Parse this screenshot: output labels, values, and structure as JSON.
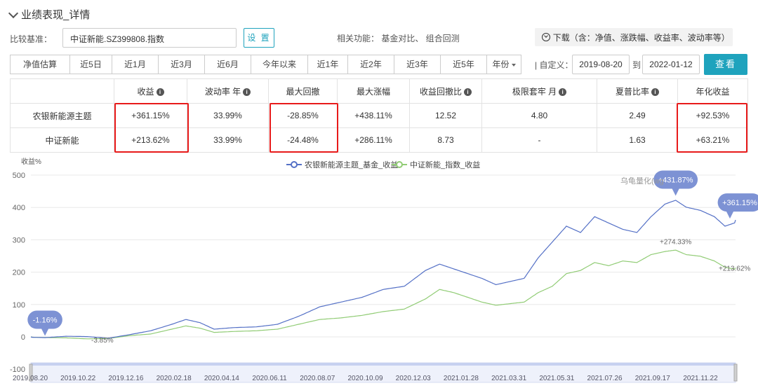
{
  "section_title": "业绩表现_详情",
  "compare": {
    "label": "比较基准：",
    "benchmark_value": "中证新能.SZ399808.指数",
    "set_button": "设 置",
    "related": "相关功能： 基金对比、 组合回测",
    "download": "下载（含：净值、涨跌幅、收益率、波动率等）"
  },
  "periods": [
    "净值估算",
    "近5日",
    "近1月",
    "近3月",
    "近6月",
    "今年以来",
    "近1年",
    "近2年",
    "近3年",
    "近5年"
  ],
  "year_select": "年份",
  "custom_label": "| 自定义：",
  "date_from": "2019-08-20",
  "to_label": "到",
  "date_to": "2022-01-12",
  "query_button": "查看",
  "table": {
    "headers": [
      "",
      "收益",
      "波动率 年",
      "最大回撤",
      "最大涨幅",
      "收益回撤比",
      "极限套牢 月",
      "夏普比率",
      "年化收益"
    ],
    "rows": [
      [
        "农银新能源主题",
        "+361.15%",
        "33.99%",
        "-28.85%",
        "+438.11%",
        "12.52",
        "4.80",
        "2.49",
        "+92.53%"
      ],
      [
        "中证新能",
        "+213.62%",
        "33.99%",
        "-24.48%",
        "+286.11%",
        "8.73",
        "-",
        "1.63",
        "+63.21%"
      ]
    ]
  },
  "colors": {
    "accent": "#1fa3bd",
    "highlight_box": "#e81a1a",
    "positive": "#e0353a",
    "negative": "#2e9a45",
    "series_fund": "#5470c6",
    "series_index": "#91cc75"
  },
  "chart_data": {
    "type": "line",
    "ylabel": "收益%",
    "ylim": [
      -100,
      500
    ],
    "yticks": [
      -100,
      0,
      100,
      200,
      300,
      400,
      500
    ],
    "grid": true,
    "legend_position": "top-center",
    "x_ticks": [
      "2019.08.20",
      "2019.10.22",
      "2019.12.16",
      "2020.02.18",
      "2020.04.14",
      "2020.06.11",
      "2020.08.07",
      "2020.10.09",
      "2020.12.03",
      "2021.01.28",
      "2021.03.31",
      "2021.05.31",
      "2021.07.26",
      "2021.09.17",
      "2021.11.22"
    ],
    "series": [
      {
        "name": "农银新能源主题_基金_收益",
        "color": "#5470c6",
        "points": [
          [
            0,
            0
          ],
          [
            0.02,
            -1.16
          ],
          [
            0.05,
            3
          ],
          [
            0.08,
            2
          ],
          [
            0.11,
            -3
          ],
          [
            0.14,
            8
          ],
          [
            0.17,
            20
          ],
          [
            0.2,
            40
          ],
          [
            0.22,
            55
          ],
          [
            0.24,
            45
          ],
          [
            0.26,
            25
          ],
          [
            0.29,
            30
          ],
          [
            0.32,
            32
          ],
          [
            0.35,
            40
          ],
          [
            0.38,
            65
          ],
          [
            0.41,
            95
          ],
          [
            0.44,
            110
          ],
          [
            0.47,
            125
          ],
          [
            0.5,
            150
          ],
          [
            0.53,
            160
          ],
          [
            0.56,
            210
          ],
          [
            0.58,
            230
          ],
          [
            0.6,
            215
          ],
          [
            0.62,
            200
          ],
          [
            0.64,
            185
          ],
          [
            0.66,
            165
          ],
          [
            0.68,
            175
          ],
          [
            0.7,
            185
          ],
          [
            0.72,
            250
          ],
          [
            0.74,
            300
          ],
          [
            0.76,
            350
          ],
          [
            0.78,
            330
          ],
          [
            0.8,
            380
          ],
          [
            0.82,
            360
          ],
          [
            0.84,
            340
          ],
          [
            0.86,
            330
          ],
          [
            0.88,
            380
          ],
          [
            0.9,
            420
          ],
          [
            0.915,
            431.87
          ],
          [
            0.93,
            410
          ],
          [
            0.95,
            400
          ],
          [
            0.97,
            380
          ],
          [
            0.985,
            350
          ],
          [
            1.0,
            361.15
          ]
        ],
        "callouts": [
          {
            "label": "-1.16%",
            "x": 0.02,
            "y": -1.16
          },
          {
            "label": "+431.87%",
            "x": 0.915,
            "y": 431.87
          },
          {
            "label": "+361.15%",
            "x": 1.0,
            "y": 361.15
          }
        ]
      },
      {
        "name": "中证新能_指数_收益",
        "color": "#91cc75",
        "points": [
          [
            0,
            0
          ],
          [
            0.05,
            -2
          ],
          [
            0.08,
            -5
          ],
          [
            0.11,
            -3.85
          ],
          [
            0.14,
            5
          ],
          [
            0.17,
            10
          ],
          [
            0.2,
            25
          ],
          [
            0.22,
            35
          ],
          [
            0.24,
            28
          ],
          [
            0.26,
            15
          ],
          [
            0.29,
            18
          ],
          [
            0.32,
            20
          ],
          [
            0.35,
            25
          ],
          [
            0.38,
            40
          ],
          [
            0.41,
            55
          ],
          [
            0.44,
            60
          ],
          [
            0.47,
            68
          ],
          [
            0.5,
            80
          ],
          [
            0.53,
            88
          ],
          [
            0.56,
            120
          ],
          [
            0.58,
            150
          ],
          [
            0.6,
            140
          ],
          [
            0.62,
            125
          ],
          [
            0.64,
            110
          ],
          [
            0.66,
            100
          ],
          [
            0.68,
            105
          ],
          [
            0.7,
            110
          ],
          [
            0.72,
            140
          ],
          [
            0.74,
            160
          ],
          [
            0.76,
            200
          ],
          [
            0.78,
            210
          ],
          [
            0.8,
            235
          ],
          [
            0.82,
            225
          ],
          [
            0.84,
            240
          ],
          [
            0.86,
            235
          ],
          [
            0.88,
            260
          ],
          [
            0.9,
            270
          ],
          [
            0.915,
            274.33
          ],
          [
            0.93,
            260
          ],
          [
            0.95,
            255
          ],
          [
            0.97,
            240
          ],
          [
            0.985,
            220
          ],
          [
            1.0,
            213.62
          ]
        ],
        "callouts": [
          {
            "label": "-3.85%",
            "x": 0.11,
            "y": -3.85
          },
          {
            "label": "+274.33%",
            "x": 0.915,
            "y": 274.33
          },
          {
            "label": "+213.62%",
            "x": 1.0,
            "y": 213.62
          }
        ]
      }
    ],
    "watermark": "乌龟量化(wg"
  }
}
